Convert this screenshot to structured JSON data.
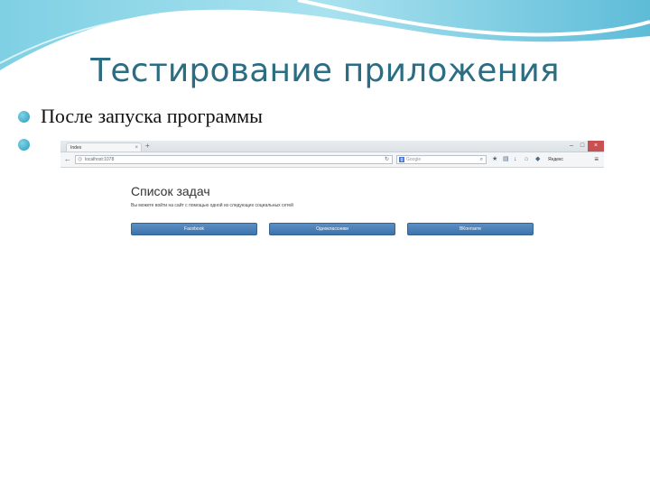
{
  "slide": {
    "title": "Тестирование приложения",
    "bullets": [
      "После запуска программы",
      ""
    ]
  },
  "browser": {
    "tab_title": "Index",
    "address": "localhost:1078",
    "search_placeholder": "Google",
    "yandex_label": "Яндекс",
    "page": {
      "heading": "Список задач",
      "description": "Вы можете войти на сайт с помощью одной из следующих социальных сетей",
      "buttons": [
        "Facebook",
        "Одноклассники",
        "ВКонтакте"
      ]
    }
  },
  "colors": {
    "title": "#2b6d82",
    "bullet": "#2a9cbc",
    "button": "#4a80b8"
  }
}
